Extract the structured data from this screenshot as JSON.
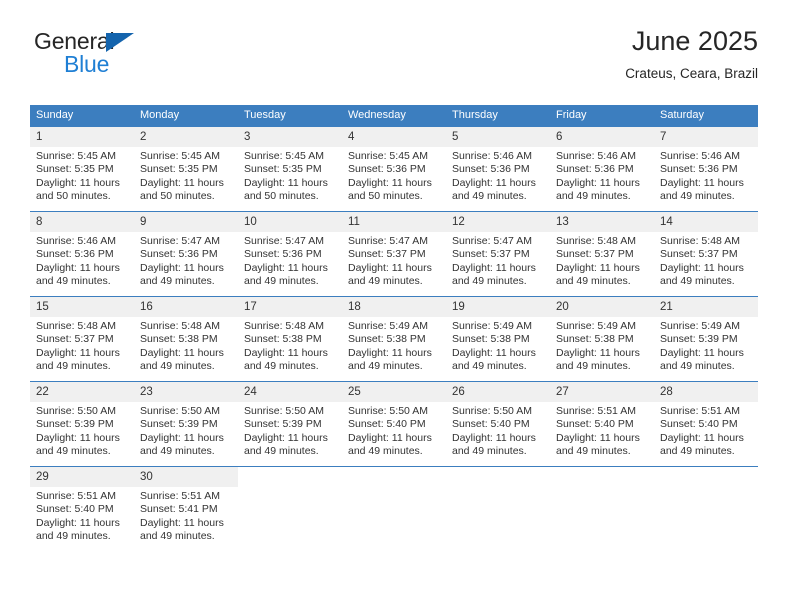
{
  "brand": {
    "name_top": "General",
    "name_bottom": "Blue",
    "triangle_color": "#1464ad",
    "blue_text_color": "#1f7fd4"
  },
  "header": {
    "title": "June 2025",
    "subtitle": "Crateus, Ceara, Brazil"
  },
  "calendar": {
    "header_bg": "#3c7ebf",
    "daynum_bg": "#f0f0f0",
    "weekday_headers": [
      "Sunday",
      "Monday",
      "Tuesday",
      "Wednesday",
      "Thursday",
      "Friday",
      "Saturday"
    ],
    "weeks": [
      [
        {
          "day": "1",
          "sunrise": "Sunrise: 5:45 AM",
          "sunset": "Sunset: 5:35 PM",
          "daylight_1": "Daylight: 11 hours",
          "daylight_2": "and 50 minutes."
        },
        {
          "day": "2",
          "sunrise": "Sunrise: 5:45 AM",
          "sunset": "Sunset: 5:35 PM",
          "daylight_1": "Daylight: 11 hours",
          "daylight_2": "and 50 minutes."
        },
        {
          "day": "3",
          "sunrise": "Sunrise: 5:45 AM",
          "sunset": "Sunset: 5:35 PM",
          "daylight_1": "Daylight: 11 hours",
          "daylight_2": "and 50 minutes."
        },
        {
          "day": "4",
          "sunrise": "Sunrise: 5:45 AM",
          "sunset": "Sunset: 5:36 PM",
          "daylight_1": "Daylight: 11 hours",
          "daylight_2": "and 50 minutes."
        },
        {
          "day": "5",
          "sunrise": "Sunrise: 5:46 AM",
          "sunset": "Sunset: 5:36 PM",
          "daylight_1": "Daylight: 11 hours",
          "daylight_2": "and 49 minutes."
        },
        {
          "day": "6",
          "sunrise": "Sunrise: 5:46 AM",
          "sunset": "Sunset: 5:36 PM",
          "daylight_1": "Daylight: 11 hours",
          "daylight_2": "and 49 minutes."
        },
        {
          "day": "7",
          "sunrise": "Sunrise: 5:46 AM",
          "sunset": "Sunset: 5:36 PM",
          "daylight_1": "Daylight: 11 hours",
          "daylight_2": "and 49 minutes."
        }
      ],
      [
        {
          "day": "8",
          "sunrise": "Sunrise: 5:46 AM",
          "sunset": "Sunset: 5:36 PM",
          "daylight_1": "Daylight: 11 hours",
          "daylight_2": "and 49 minutes."
        },
        {
          "day": "9",
          "sunrise": "Sunrise: 5:47 AM",
          "sunset": "Sunset: 5:36 PM",
          "daylight_1": "Daylight: 11 hours",
          "daylight_2": "and 49 minutes."
        },
        {
          "day": "10",
          "sunrise": "Sunrise: 5:47 AM",
          "sunset": "Sunset: 5:36 PM",
          "daylight_1": "Daylight: 11 hours",
          "daylight_2": "and 49 minutes."
        },
        {
          "day": "11",
          "sunrise": "Sunrise: 5:47 AM",
          "sunset": "Sunset: 5:37 PM",
          "daylight_1": "Daylight: 11 hours",
          "daylight_2": "and 49 minutes."
        },
        {
          "day": "12",
          "sunrise": "Sunrise: 5:47 AM",
          "sunset": "Sunset: 5:37 PM",
          "daylight_1": "Daylight: 11 hours",
          "daylight_2": "and 49 minutes."
        },
        {
          "day": "13",
          "sunrise": "Sunrise: 5:48 AM",
          "sunset": "Sunset: 5:37 PM",
          "daylight_1": "Daylight: 11 hours",
          "daylight_2": "and 49 minutes."
        },
        {
          "day": "14",
          "sunrise": "Sunrise: 5:48 AM",
          "sunset": "Sunset: 5:37 PM",
          "daylight_1": "Daylight: 11 hours",
          "daylight_2": "and 49 minutes."
        }
      ],
      [
        {
          "day": "15",
          "sunrise": "Sunrise: 5:48 AM",
          "sunset": "Sunset: 5:37 PM",
          "daylight_1": "Daylight: 11 hours",
          "daylight_2": "and 49 minutes."
        },
        {
          "day": "16",
          "sunrise": "Sunrise: 5:48 AM",
          "sunset": "Sunset: 5:38 PM",
          "daylight_1": "Daylight: 11 hours",
          "daylight_2": "and 49 minutes."
        },
        {
          "day": "17",
          "sunrise": "Sunrise: 5:48 AM",
          "sunset": "Sunset: 5:38 PM",
          "daylight_1": "Daylight: 11 hours",
          "daylight_2": "and 49 minutes."
        },
        {
          "day": "18",
          "sunrise": "Sunrise: 5:49 AM",
          "sunset": "Sunset: 5:38 PM",
          "daylight_1": "Daylight: 11 hours",
          "daylight_2": "and 49 minutes."
        },
        {
          "day": "19",
          "sunrise": "Sunrise: 5:49 AM",
          "sunset": "Sunset: 5:38 PM",
          "daylight_1": "Daylight: 11 hours",
          "daylight_2": "and 49 minutes."
        },
        {
          "day": "20",
          "sunrise": "Sunrise: 5:49 AM",
          "sunset": "Sunset: 5:38 PM",
          "daylight_1": "Daylight: 11 hours",
          "daylight_2": "and 49 minutes."
        },
        {
          "day": "21",
          "sunrise": "Sunrise: 5:49 AM",
          "sunset": "Sunset: 5:39 PM",
          "daylight_1": "Daylight: 11 hours",
          "daylight_2": "and 49 minutes."
        }
      ],
      [
        {
          "day": "22",
          "sunrise": "Sunrise: 5:50 AM",
          "sunset": "Sunset: 5:39 PM",
          "daylight_1": "Daylight: 11 hours",
          "daylight_2": "and 49 minutes."
        },
        {
          "day": "23",
          "sunrise": "Sunrise: 5:50 AM",
          "sunset": "Sunset: 5:39 PM",
          "daylight_1": "Daylight: 11 hours",
          "daylight_2": "and 49 minutes."
        },
        {
          "day": "24",
          "sunrise": "Sunrise: 5:50 AM",
          "sunset": "Sunset: 5:39 PM",
          "daylight_1": "Daylight: 11 hours",
          "daylight_2": "and 49 minutes."
        },
        {
          "day": "25",
          "sunrise": "Sunrise: 5:50 AM",
          "sunset": "Sunset: 5:40 PM",
          "daylight_1": "Daylight: 11 hours",
          "daylight_2": "and 49 minutes."
        },
        {
          "day": "26",
          "sunrise": "Sunrise: 5:50 AM",
          "sunset": "Sunset: 5:40 PM",
          "daylight_1": "Daylight: 11 hours",
          "daylight_2": "and 49 minutes."
        },
        {
          "day": "27",
          "sunrise": "Sunrise: 5:51 AM",
          "sunset": "Sunset: 5:40 PM",
          "daylight_1": "Daylight: 11 hours",
          "daylight_2": "and 49 minutes."
        },
        {
          "day": "28",
          "sunrise": "Sunrise: 5:51 AM",
          "sunset": "Sunset: 5:40 PM",
          "daylight_1": "Daylight: 11 hours",
          "daylight_2": "and 49 minutes."
        }
      ],
      [
        {
          "day": "29",
          "sunrise": "Sunrise: 5:51 AM",
          "sunset": "Sunset: 5:40 PM",
          "daylight_1": "Daylight: 11 hours",
          "daylight_2": "and 49 minutes."
        },
        {
          "day": "30",
          "sunrise": "Sunrise: 5:51 AM",
          "sunset": "Sunset: 5:41 PM",
          "daylight_1": "Daylight: 11 hours",
          "daylight_2": "and 49 minutes."
        },
        {
          "day": "",
          "sunrise": "",
          "sunset": "",
          "daylight_1": "",
          "daylight_2": ""
        },
        {
          "day": "",
          "sunrise": "",
          "sunset": "",
          "daylight_1": "",
          "daylight_2": ""
        },
        {
          "day": "",
          "sunrise": "",
          "sunset": "",
          "daylight_1": "",
          "daylight_2": ""
        },
        {
          "day": "",
          "sunrise": "",
          "sunset": "",
          "daylight_1": "",
          "daylight_2": ""
        },
        {
          "day": "",
          "sunrise": "",
          "sunset": "",
          "daylight_1": "",
          "daylight_2": ""
        }
      ]
    ]
  }
}
